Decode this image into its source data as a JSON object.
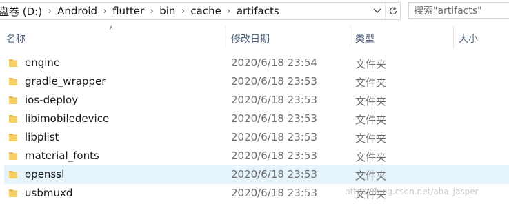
{
  "address_bar": {
    "crumbs": [
      "盘卷 (D:)",
      "Android",
      "flutter",
      "bin",
      "cache",
      "artifacts"
    ],
    "search_placeholder": "搜索\"artifacts\""
  },
  "columns": {
    "name": "名称",
    "modified": "修改日期",
    "type": "类型",
    "size": "大小"
  },
  "files": [
    {
      "name": "engine",
      "modified": "2020/6/18 23:54",
      "type": "文件夹",
      "icon": "folder-icon"
    },
    {
      "name": "gradle_wrapper",
      "modified": "2020/6/18 23:53",
      "type": "文件夹",
      "icon": "folder-icon"
    },
    {
      "name": "ios-deploy",
      "modified": "2020/6/18 23:53",
      "type": "文件夹",
      "icon": "folder-icon"
    },
    {
      "name": "libimobiledevice",
      "modified": "2020/6/18 23:53",
      "type": "文件夹",
      "icon": "folder-icon"
    },
    {
      "name": "libplist",
      "modified": "2020/6/18 23:53",
      "type": "文件夹",
      "icon": "folder-icon"
    },
    {
      "name": "material_fonts",
      "modified": "2020/6/18 23:53",
      "type": "文件夹",
      "icon": "folder-icon"
    },
    {
      "name": "openssl",
      "modified": "2020/6/18 23:53",
      "type": "文件夹",
      "icon": "folder-icon",
      "selected": true
    },
    {
      "name": "usbmuxd",
      "modified": "2020/6/18 23:53",
      "type": "文件夹",
      "icon": "folder-icon"
    }
  ],
  "watermark": "https://blog.csdn.net/aha_jasper",
  "colors": {
    "selected_row": "#e5f3fb",
    "folder": "#e8b94a",
    "header_text": "#4c607a"
  }
}
